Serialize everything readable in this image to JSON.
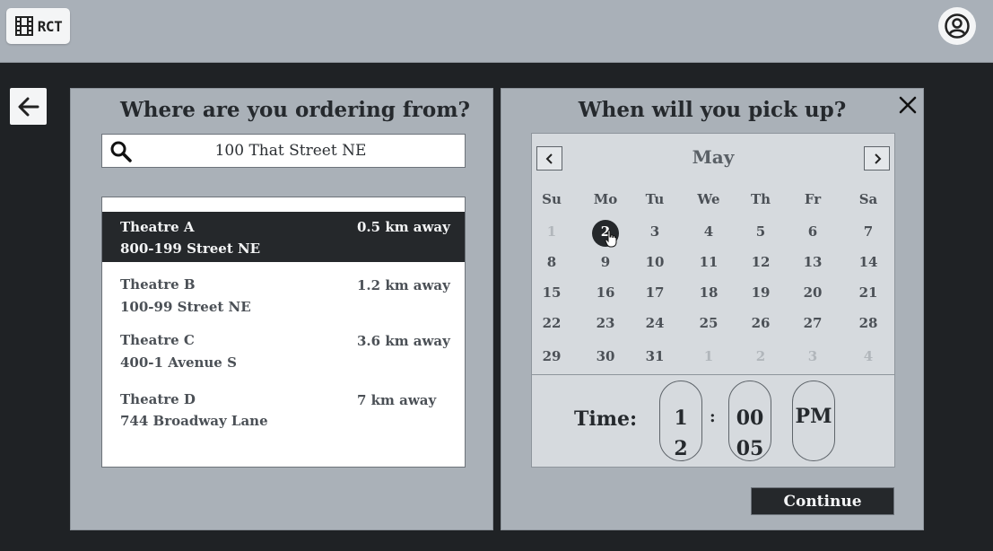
{
  "header": {
    "logo_text": "RCT",
    "logo_icon": "film-strip-icon",
    "account_icon": "user-circle-icon"
  },
  "nav": {
    "back_icon": "arrow-left-icon"
  },
  "location": {
    "title": "Where are you ordering from?",
    "search_icon": "search-icon",
    "search_value": "100 That Street NE",
    "theatres": [
      {
        "name": "Theatre A",
        "address": "800-199 Street NE",
        "distance": "0.5 km away",
        "selected": true
      },
      {
        "name": "Theatre B",
        "address": "100-99 Street NE",
        "distance": "1.2 km away",
        "selected": false
      },
      {
        "name": "Theatre C",
        "address": "400-1 Avenue S",
        "distance": "3.6 km away",
        "selected": false
      },
      {
        "name": "Theatre D",
        "address": "744 Broadway Lane",
        "distance": "7 km away",
        "selected": false
      }
    ]
  },
  "pickup": {
    "title": "When will you pick up?",
    "close_icon": "close-icon",
    "calendar": {
      "month": "May",
      "prev_icon": "chevron-left-icon",
      "next_icon": "chevron-right-icon",
      "weekdays": [
        "Su",
        "Mo",
        "Tu",
        "We",
        "Th",
        "Fr",
        "Sa"
      ],
      "weeks": [
        [
          "1",
          "2",
          "3",
          "4",
          "5",
          "6",
          "7"
        ],
        [
          "8",
          "9",
          "10",
          "11",
          "12",
          "13",
          "14"
        ],
        [
          "15",
          "16",
          "17",
          "18",
          "19",
          "20",
          "21"
        ],
        [
          "22",
          "23",
          "24",
          "25",
          "26",
          "27",
          "28"
        ],
        [
          "29",
          "30",
          "31",
          "1",
          "2",
          "3",
          "4"
        ]
      ],
      "selected_day": "2"
    },
    "time": {
      "label": "Time:",
      "hour": "1",
      "hour_next": "2",
      "separator": ":",
      "minute": "00",
      "minute_next": "05",
      "period": "PM"
    },
    "continue_label": "Continue"
  },
  "colors": {
    "accent_dark": "#25282b",
    "panel": "#aab1b8",
    "calendar_bg": "#d6dade"
  }
}
